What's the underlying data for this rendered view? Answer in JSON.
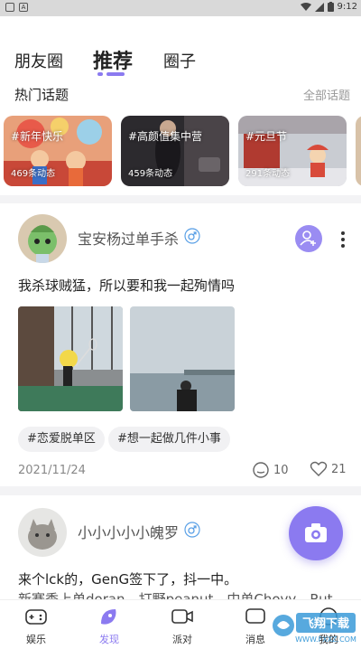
{
  "status_bar": {
    "time": "9:12",
    "left_icons": [
      "square-icon",
      "a-icon"
    ],
    "right_icons": [
      "wifi-icon",
      "signal-icon",
      "battery-icon"
    ]
  },
  "tabs": [
    {
      "label": "朋友圈",
      "active": false
    },
    {
      "label": "推荐",
      "active": true
    },
    {
      "label": "圈子",
      "active": false
    }
  ],
  "hot_topics": {
    "title": "热门话题",
    "all_label": "全部话题",
    "items": [
      {
        "name": "#新年快乐",
        "count": "469条动态"
      },
      {
        "name": "#高颜值集中营",
        "count": "459条动态"
      },
      {
        "name": "#元旦节",
        "count": "291条动态"
      }
    ]
  },
  "posts": [
    {
      "username": "宝安杨过单手杀",
      "gender": "male",
      "text": "我杀球贼猛，所以要和我一起殉情吗",
      "tags": [
        "#恋爱脱单区",
        "#想一起做几件小事"
      ],
      "date": "2021/11/24",
      "comments": "10",
      "likes": "21"
    },
    {
      "username": "小小小小小魄罗",
      "gender": "male",
      "text": "来个lck的，GenG签下了，抖一中。",
      "text2": "新赛季上单doran，打野peanut，中单Chovy，Rut"
    }
  ],
  "bottom_nav": [
    {
      "label": "娱乐",
      "icon": "gamepad-icon",
      "active": false
    },
    {
      "label": "发现",
      "icon": "discover-icon",
      "active": true
    },
    {
      "label": "派对",
      "icon": "video-icon",
      "active": false
    },
    {
      "label": "消息",
      "icon": "message-icon",
      "active": false
    },
    {
      "label": "我的",
      "icon": "profile-icon",
      "active": false
    }
  ],
  "watermark": {
    "text": "飞翔下载",
    "url_text": "WWW.FXXZ.COM"
  },
  "colors": {
    "accent": "#8b7af0",
    "gender_male": "#5aa0e6"
  }
}
